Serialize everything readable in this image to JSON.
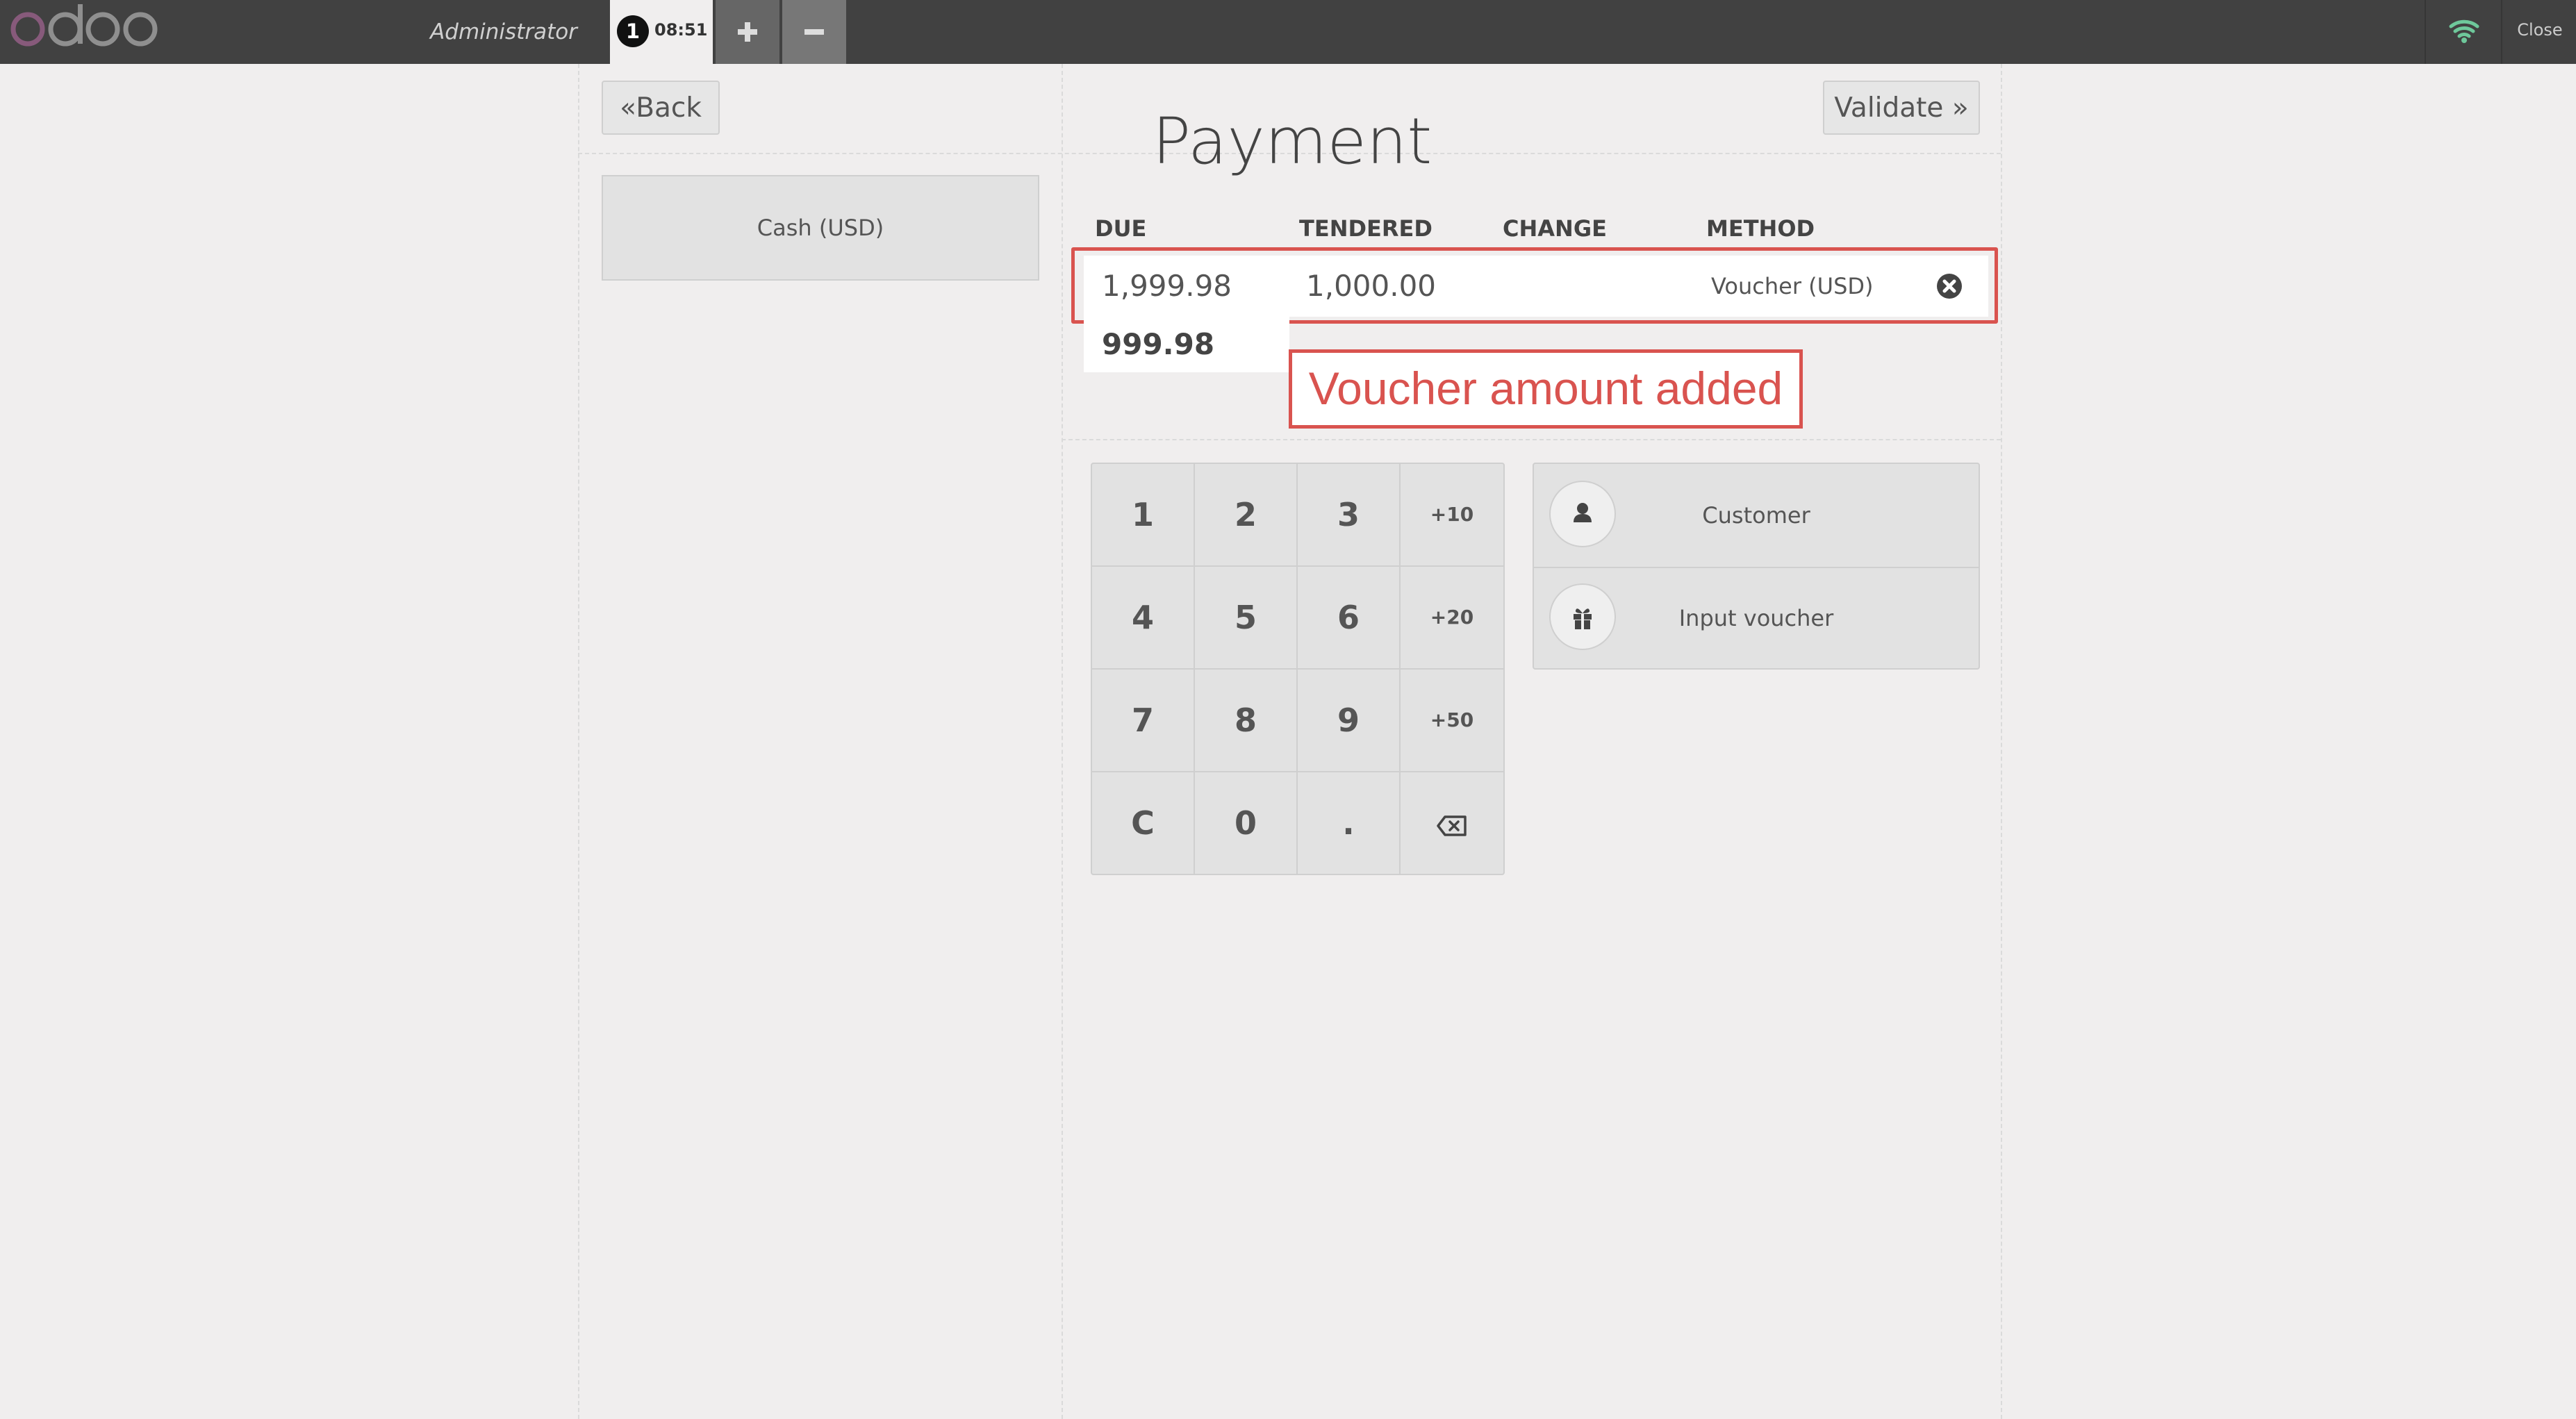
{
  "topbar": {
    "user": "Administrator",
    "order_number": "1",
    "order_time": "08:51",
    "close_label": "Close"
  },
  "screen": {
    "back_label": "Back",
    "validate_label": "Validate",
    "title": "Payment",
    "payment_methods": [
      "Cash (USD)"
    ]
  },
  "paymentlines": {
    "headers": {
      "due": "DUE",
      "tendered": "TENDERED",
      "change": "CHANGE",
      "method": "METHOD"
    },
    "lines": [
      {
        "due": "1,999.98",
        "tendered": "1,000.00",
        "change": "",
        "method": "Voucher (USD)"
      }
    ],
    "remaining": "999.98"
  },
  "annotation": {
    "text": "Voucher amount added",
    "color": "#d9534f"
  },
  "numpad": {
    "keys": [
      "1",
      "2",
      "3",
      "+10",
      "4",
      "5",
      "6",
      "+20",
      "7",
      "8",
      "9",
      "+50",
      "C",
      "0",
      ".",
      "backspace"
    ]
  },
  "actions": {
    "customer_label": "Customer",
    "voucher_label": "Input voucher"
  },
  "colors": {
    "topbar": "#414141",
    "background": "#f0eeee",
    "wifi": "#6ec89b",
    "logo_accent": "#875a7b"
  },
  "icons": [
    "wifi-icon",
    "close-circle-icon",
    "user-icon",
    "gift-icon",
    "backspace-icon",
    "double-chevron-left-icon",
    "double-chevron-right-icon"
  ]
}
